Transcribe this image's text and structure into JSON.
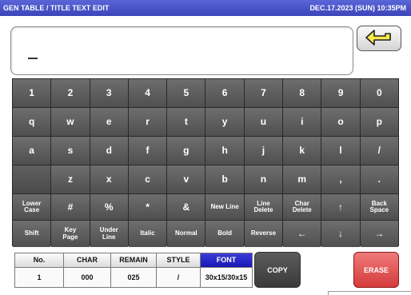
{
  "header": {
    "title": "GEN TABLE / TITLE TEXT EDIT",
    "datetime": "DEC.17.2023 (SUN)  10:35PM"
  },
  "editor": {
    "text": "",
    "caret_icon": "underline-caret"
  },
  "enter_icon": "enter-return-arrow",
  "keyboard": {
    "row1": [
      "1",
      "2",
      "3",
      "4",
      "5",
      "6",
      "7",
      "8",
      "9",
      "0"
    ],
    "row2": [
      "q",
      "w",
      "e",
      "r",
      "t",
      "y",
      "u",
      "i",
      "o",
      "p"
    ],
    "row3": [
      "a",
      "s",
      "d",
      "f",
      "g",
      "h",
      "j",
      "k",
      "l",
      "/"
    ],
    "row4": [
      "",
      "z",
      "x",
      "c",
      "v",
      "b",
      "n",
      "m",
      ",",
      "."
    ],
    "row5": [
      "Lower\nCase",
      "#",
      "%",
      "*",
      "&",
      "New Line",
      "Line\nDelete",
      "Char\nDelete",
      "↑",
      "Back\nSpace"
    ],
    "row6": [
      "Shift",
      "Key\nPage",
      "Under\nLine",
      "Italic",
      "Normal",
      "Bold",
      "Reverse",
      "←",
      "↓",
      "→"
    ]
  },
  "status": {
    "no_label": "No.",
    "no_value": "1",
    "char_label": "CHAR",
    "char_value": "000",
    "remain_label": "REMAIN",
    "remain_value": "025",
    "style_label": "STYLE",
    "style_value": "/",
    "font_label": "FONT",
    "font_value": "30x15/30x15"
  },
  "buttons": {
    "copy": "COPY",
    "erase": "ERASE"
  },
  "colors": {
    "titlebar": "#3b44b8",
    "key": "#595959",
    "font_header": "#2020c0",
    "erase": "#d94a4a"
  }
}
